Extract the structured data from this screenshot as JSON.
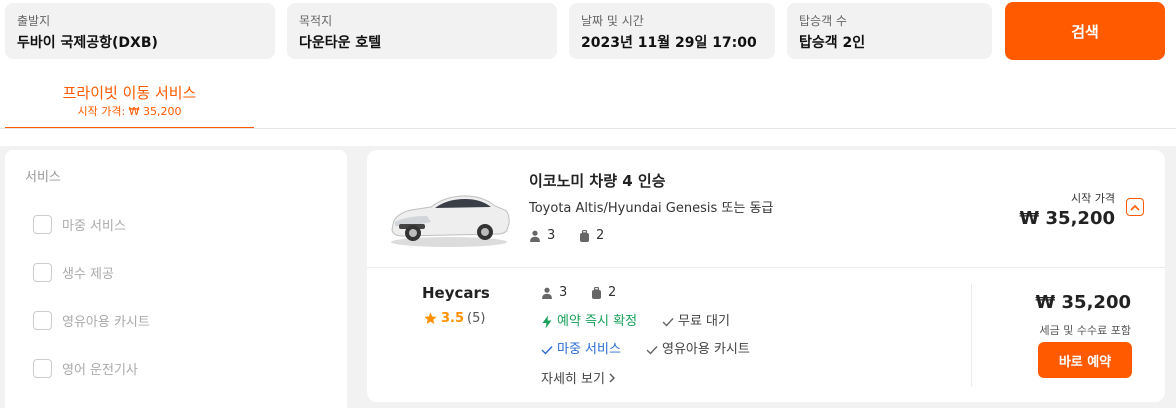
{
  "search": {
    "origin": {
      "label": "출발지",
      "value": "두바이 국제공항(DXB)"
    },
    "destination": {
      "label": "목적지",
      "value": "다운타운 호텔"
    },
    "datetime": {
      "label": "날짜 및 시간",
      "value": "2023년 11월 29일 17:00"
    },
    "passengers": {
      "label": "탑승객 수",
      "value": "탑승객 2인"
    },
    "button": "검색"
  },
  "tab": {
    "title": "프라이빗 이동 서비스",
    "subtitle": "시작 가격: ₩ 35,200"
  },
  "sidebar": {
    "heading": "서비스",
    "options": [
      "마중 서비스",
      "생수 제공",
      "영유아용 카시트",
      "영어 운전기사"
    ]
  },
  "result": {
    "title": "이코노미 차량 4 인승",
    "subtitle": "Toyota Altis/Hyundai Genesis 또는 동급",
    "passengers": "3",
    "luggage": "2",
    "from_label": "시작 가격",
    "from_price": "₩ 35,200",
    "supplier": {
      "name": "Heycars",
      "rating": "3.5",
      "reviews": "(5)",
      "passengers": "3",
      "luggage": "2",
      "features": {
        "instant": "예약 즉시 확정",
        "wait": "무료 대기",
        "meet": "마중 서비스",
        "child_seat": "영유아용 카시트"
      },
      "more": "자세히 보기",
      "price": "₩ 35,200",
      "note": "세금 및 수수료 포함",
      "book": "바로 예약"
    }
  },
  "colors": {
    "accent": "#ff5a00",
    "green": "#18a058",
    "blue": "#2b6cd1",
    "star": "#ff9000"
  }
}
